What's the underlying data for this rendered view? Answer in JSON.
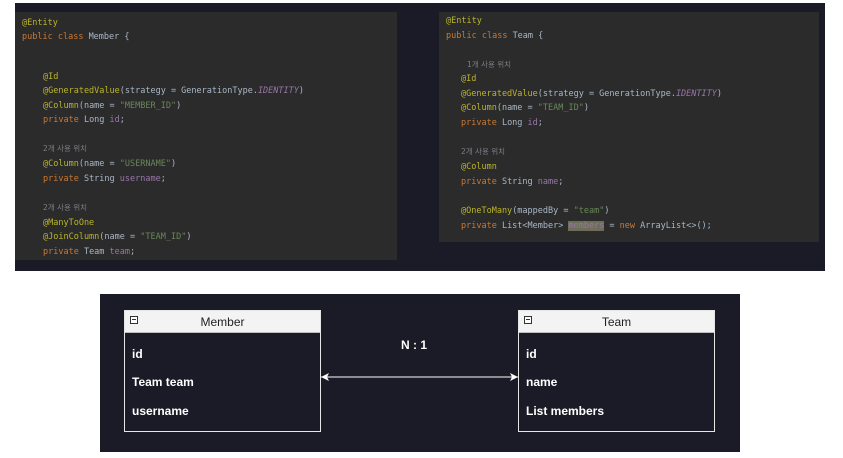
{
  "member_code": {
    "line1_annotation": "@Entity",
    "line2_kw1": "public",
    "line2_kw2": "class",
    "line2_name": "Member {",
    "id_ann": "@Id",
    "gen_ann": "@GeneratedValue",
    "gen_args": "(strategy = GenerationType.",
    "gen_const": "IDENTITY",
    "gen_close": ")",
    "col1_ann": "@Column",
    "col1_args": "(name = ",
    "col1_str": "\"MEMBER_ID\"",
    "col1_close": ")",
    "f1_kw": "private",
    "f1_type": " Long ",
    "f1_name": "id",
    "f1_end": ";",
    "cmt2": "2개 사용 위치",
    "col2_ann": "@Column",
    "col2_args": "(name = ",
    "col2_str": "\"USERNAME\"",
    "col2_close": ")",
    "f2_kw": "private",
    "f2_type": " String ",
    "f2_name": "username",
    "f2_end": ";",
    "cmt3": "2개 사용 위치",
    "m2o_ann": "@ManyToOne",
    "jc_ann": "@JoinColumn",
    "jc_args": "(name = ",
    "jc_str": "\"TEAM_ID\"",
    "jc_close": ")",
    "f3_kw": "private",
    "f3_type": " Team ",
    "f3_name": "team",
    "f3_end": ";"
  },
  "team_code": {
    "line1_annotation": "@Entity",
    "line2_kw1": "public",
    "line2_kw2": "class",
    "line2_name": "Team {",
    "cmt1": "1개 사용 위치",
    "id_ann": "@Id",
    "gen_ann": "@GeneratedValue",
    "gen_args": "(strategy = GenerationType.",
    "gen_const": "IDENTITY",
    "gen_close": ")",
    "col1_ann": "@Column",
    "col1_args": "(name = ",
    "col1_str": "\"TEAM_ID\"",
    "col1_close": ")",
    "f1_kw": "private",
    "f1_type": " Long ",
    "f1_name": "id",
    "f1_end": ";",
    "cmt2": "2개 사용 위치",
    "col2_ann": "@Column",
    "f2_kw": "private",
    "f2_type": " String ",
    "f2_name": "name",
    "f2_end": ";",
    "o2m_ann": "@OneToMany",
    "o2m_args": "(mappedBy = ",
    "o2m_str": "\"team\"",
    "o2m_close": ")",
    "f3_kw": "private",
    "f3_type": " List<Member> ",
    "f3_name": "members",
    "f3_mid": " = ",
    "f3_new": "new",
    "f3_end": " ArrayList<>();"
  },
  "diagram": {
    "member": {
      "title": "Member",
      "fields": [
        "id",
        "Team team",
        "username"
      ]
    },
    "team": {
      "title": "Team",
      "fields": [
        "id",
        "name",
        "List members"
      ]
    },
    "relation_label": "N : 1"
  }
}
